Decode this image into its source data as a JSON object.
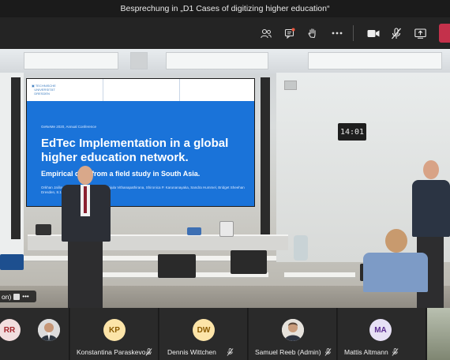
{
  "window": {
    "title": "Besprechung in „D1 Cases of digitizing higher education“"
  },
  "toolbar": {
    "icons": [
      "participants-icon",
      "chat-icon",
      "raise-hand-icon",
      "more-options-icon",
      "camera-icon",
      "mic-muted-icon",
      "share-screen-icon",
      "leave-icon"
    ]
  },
  "video": {
    "slide": {
      "conference": "GeNeMe 2020, Annual Conference",
      "title": "EdTec Implementation in a global higher education network.",
      "subtitle": "Empirical data from a field study in South Asia.",
      "authors": "Orkhan Jalilov, Thi Thuy Hanh Nguyen, Manjula Vithanapathirana, Shironica P. Karunanayaka, Sandra Hummel, Bridget Sheehan",
      "location": "Dresden, 8.10.2020"
    },
    "clock": "14:01",
    "label": "on)"
  },
  "participants": [
    {
      "initials": "RR",
      "name": "",
      "kind": "avatar",
      "color": "#f2dede",
      "text_color": "#a4262c",
      "muted": false
    },
    {
      "initials": "",
      "name": "",
      "kind": "photo",
      "muted": false
    },
    {
      "initials": "KP",
      "name": "Konstantina Paraskevo...",
      "kind": "avatar",
      "color": "#fce4a8",
      "text_color": "#8a5a00",
      "muted": true
    },
    {
      "initials": "DW",
      "name": "Dennis Wittchen",
      "kind": "avatar",
      "color": "#fce4a8",
      "text_color": "#8a5a00",
      "muted": true
    },
    {
      "initials": "",
      "name": "Samuel Reeb (Admin)",
      "kind": "photo",
      "muted": true
    },
    {
      "initials": "MA",
      "name": "Mattis Altmann",
      "kind": "avatar",
      "color": "#e7e0f5",
      "text_color": "#5c2e91",
      "muted": true
    }
  ]
}
